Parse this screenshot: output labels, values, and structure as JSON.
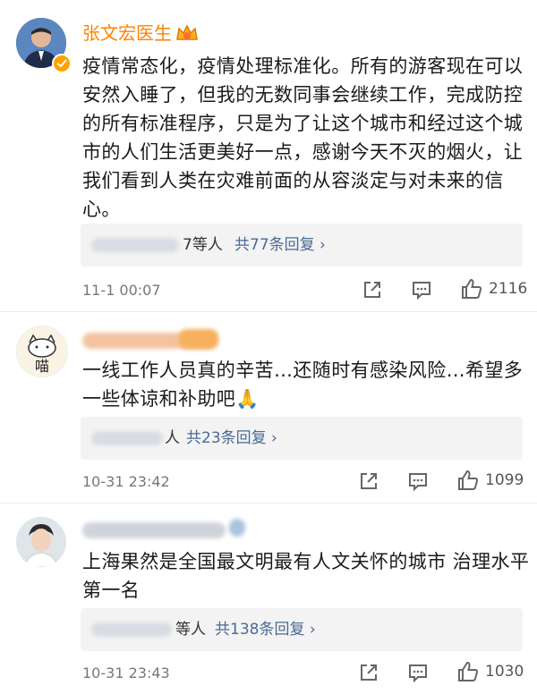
{
  "comments": [
    {
      "name": "张文宏医生",
      "text": "疫情常态化，疫情处理标准化。所有的游客现在可以安然入睡了，但我的无数同事会继续工作，完成防控的所有标准程序，只是为了让这个城市和经过这个城市的人们生活更美好一点，感谢今天不灭的烟火，让我们看到人类在灾难前面的从容淡定与对未来的信心。",
      "reply_suffix": "7等人",
      "reply_count": "共77条回复 ›",
      "time": "11-1 00:07",
      "likes": "2116"
    },
    {
      "name": "",
      "text": "一线工作人员真的辛苦…还随时有感染风险…希望多一些体谅和补助吧🙏",
      "reply_suffix": "人",
      "reply_count": "共23条回复 ›",
      "time": "10-31 23:42",
      "likes": "1099"
    },
    {
      "name": "",
      "text": "上海果然是全国最文明最有人文关怀的城市 治理水平第一名",
      "reply_suffix": "等人",
      "reply_count": "共138条回复 ›",
      "time": "10-31 23:43",
      "likes": "1030"
    }
  ],
  "icons": {
    "share": "share-icon",
    "comment": "comment-icon",
    "like": "thumb-up-icon",
    "vip": "crown-badge-icon",
    "verified": "verified-badge-icon"
  },
  "colors": {
    "name_orange": "#ff8200",
    "reply_blue": "#4a6a96",
    "meta_gray": "#777777"
  }
}
